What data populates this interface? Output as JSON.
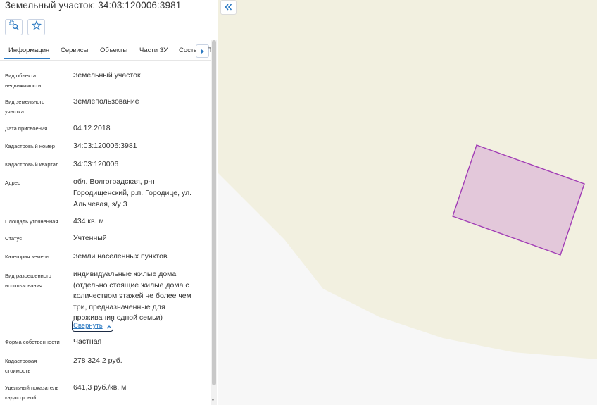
{
  "header": {
    "title": "Земельный участок: 34:03:120006:3981"
  },
  "tabs": [
    {
      "label": "Информация"
    },
    {
      "label": "Сервисы"
    },
    {
      "label": "Объекты"
    },
    {
      "label": "Части ЗУ"
    },
    {
      "label": "Соста"
    }
  ],
  "tabs_overflow_text": "Т",
  "fields": [
    {
      "label": "Вид объекта недвижимости",
      "value": "Земельный участок"
    },
    {
      "label": "Вид земельного участка",
      "value": "Землепользование"
    },
    {
      "label": "Дата присвоения",
      "value": "04.12.2018"
    },
    {
      "label": "Кадастровый номер",
      "value": "34:03:120006:3981"
    },
    {
      "label": "Кадастровый квартал",
      "value": "34:03:120006"
    },
    {
      "label": "Адрес",
      "value": "обл. Волгоградская, р-н Городищенский, р.п. Городице, ул. Алычевая, з/у 3"
    },
    {
      "label": "Площадь уточненная",
      "value": "434 кв. м"
    },
    {
      "label": "Статус",
      "value": "Учтенный"
    },
    {
      "label": "Категория земель",
      "value": "Земли населенных пунктов"
    },
    {
      "label": "Вид разрешенного использования",
      "value": "индивидуальные жилые дома (отдельно стоящие жилые дома с количеством этажей не более чем три, предназначенные для проживания одной семьи)"
    },
    {
      "label": "Форма собственности",
      "value": "Частная"
    },
    {
      "label": "Кадастровая стоимость",
      "value": "278 324,2 руб."
    },
    {
      "label": "Удельный показатель кадастровой",
      "value": "641,3 руб./кв. м"
    }
  ],
  "collapse_label": "Свернуть",
  "icons": {
    "search_map": "map-search-icon",
    "favorite": "star-icon",
    "tabs_next": "chevron-right-icon",
    "collapse": "chevron-up-icon",
    "panel_toggle": "double-chevron-left-icon"
  },
  "colors": {
    "accent": "#2b79c2",
    "parcel_fill": "#e3c8da",
    "parcel_stroke": "#a13cb5",
    "map_land": "#f2f0e0",
    "map_road": "#f7f7f7"
  }
}
